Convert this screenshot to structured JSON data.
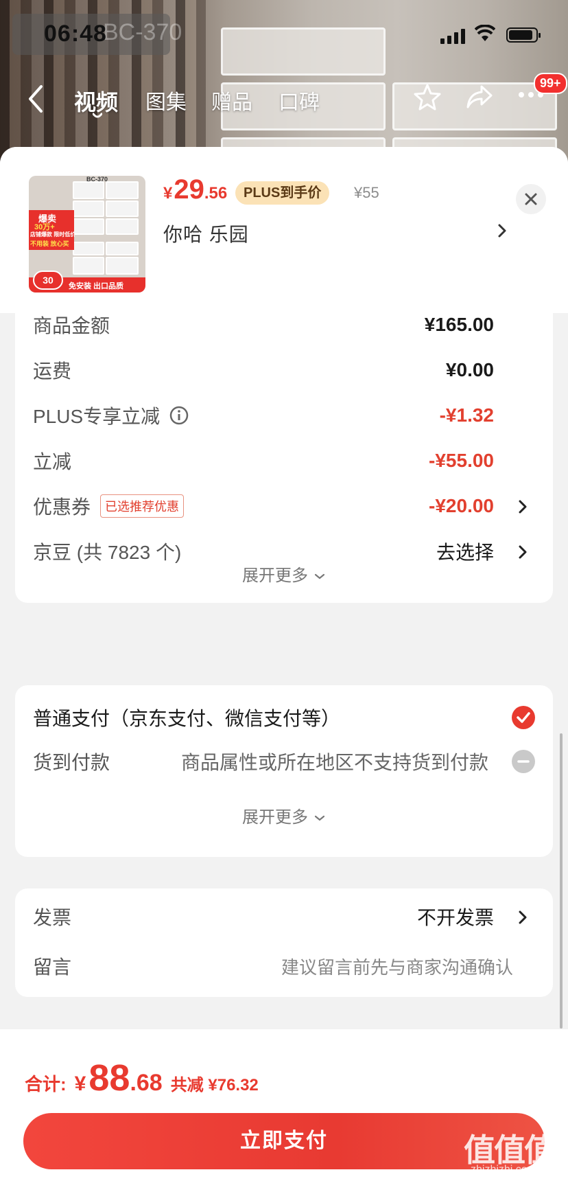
{
  "status_bar": {
    "time": "06:48",
    "ghost_text": "BC-370"
  },
  "nav": {
    "tabs": [
      {
        "label": "视频"
      },
      {
        "label": "图集"
      },
      {
        "label": "赠品"
      },
      {
        "label": "口碑"
      }
    ],
    "active_tab": "视频",
    "badge": "99+",
    "icons": [
      "back-arrow-icon",
      "star-icon",
      "share-icon",
      "more-icon"
    ]
  },
  "product": {
    "thumbnail": {
      "code": "BC-370",
      "tag1": "爆卖",
      "tag2": "30万+",
      "tag3": "店铺爆款 限时低价",
      "tag4": "不用装 放心买",
      "tag5": "免安装 出口品质",
      "badge": "30"
    },
    "price_symbol": "¥",
    "price_int": "29",
    "price_dec": ".56",
    "plus_tag": "PLUS到手价",
    "original_price": "¥55",
    "shop": "你哈  乐园"
  },
  "fees": {
    "rows": [
      {
        "label": "商品金额",
        "value": "¥165.00"
      },
      {
        "label": "运费",
        "value": "¥0.00"
      },
      {
        "label": "PLUS专享立减",
        "value": "-¥1.32"
      },
      {
        "label": "立减",
        "value": "-¥55.00"
      },
      {
        "label": "优惠券",
        "tag": "已选推荐优惠",
        "value": "-¥20.00"
      },
      {
        "label": "京豆 (共 7823 个)",
        "value": "去选择"
      }
    ],
    "expand": "展开更多"
  },
  "payment": {
    "options": [
      {
        "label": "普通支付（京东支付、微信支付等）",
        "selected": true
      },
      {
        "label": "货到付款",
        "note": "商品属性或所在地区不支持货到付款",
        "selected": false
      }
    ],
    "expand": "展开更多"
  },
  "extra": {
    "invoice_label": "发票",
    "invoice_value": "不开发票",
    "message_label": "留言",
    "message_placeholder": "建议留言前先与商家沟通确认"
  },
  "footer": {
    "total_label": "合计:",
    "total_symbol": "¥",
    "total_int": "88",
    "total_dec": ".68",
    "saved": "共减 ¥76.32",
    "pay_button": "立即支付",
    "watermark": "值值值",
    "watermark_sub": "zhizhizhi.com"
  },
  "colors": {
    "accent": "#e83a2f",
    "plus_tag_bg": "#fbe2b6"
  }
}
